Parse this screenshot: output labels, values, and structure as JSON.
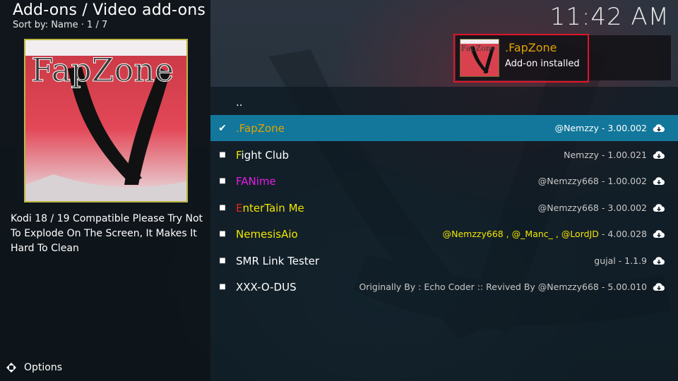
{
  "header": {
    "title": "Add-ons / Video add-ons",
    "subtitle": "Sort by: Name  ·  1 / 7",
    "clock": "11:42 AM"
  },
  "preview": {
    "image_name": "fapzone-addon-artwork",
    "logo_text": "FapZone",
    "description": "Kodi 18 / 19 Compatible Please Try Not To Explode On The Screen, It Makes It Hard To Clean"
  },
  "footer": {
    "options_label": "Options",
    "options_icon": "options-arrows-icon"
  },
  "list": {
    "parent_label": "..",
    "items": [
      {
        "label": ".FapZone",
        "meta": "@Nemzzy - 3.00.002",
        "selected": true,
        "label_color": "#e0a300",
        "meta_color": "#ffffff",
        "icon": "download-cloud-icon"
      },
      {
        "label": "Fight Club",
        "meta": "Nemzzy - 1.00.021",
        "selected": false,
        "first_letter_color": "#f2e600",
        "label_color": "#ffffff",
        "meta_color": "#c8c8c8",
        "icon": "download-cloud-icon"
      },
      {
        "label": "FANime",
        "meta": "@Nemzzy668 - 1.00.002",
        "selected": false,
        "label_color": "#e61ee6",
        "meta_color": "#c8c8c8",
        "icon": "download-cloud-icon"
      },
      {
        "label": "EnterTain Me",
        "meta": "@Nemzzy668 - 3.00.002",
        "selected": false,
        "first_letter_color": "#e02a1a",
        "label_color": "#f2e600",
        "meta_color": "#c8c8c8",
        "icon": "download-cloud-icon"
      },
      {
        "label": "NemesisAio",
        "meta": "@Nemzzy668 , @_Manc_ , @LordJD - 4.00.028",
        "selected": false,
        "label_color": "#f2e600",
        "meta_color": "#f2e600",
        "meta_tail_color": "#c8c8c8",
        "icon": "download-cloud-icon"
      },
      {
        "label": "SMR Link Tester",
        "meta": "gujal - 1.1.9",
        "selected": false,
        "label_color": "#ffffff",
        "meta_color": "#c8c8c8",
        "icon": "download-cloud-icon"
      },
      {
        "label": "XXX-O-DUS",
        "meta": "Originally By : Echo Coder :: Revived By @Nemzzy668 - 5.00.010",
        "selected": false,
        "label_color": "#ffffff",
        "meta_color": "#c8c8c8",
        "icon": "download-cloud-icon"
      }
    ]
  },
  "notification": {
    "title": ".FapZone",
    "message": "Add-on installed",
    "image_name": "fapzone-addon-artwork",
    "logo_text": "FapZone"
  },
  "colors": {
    "selection": "#12779b",
    "accent_orange": "#e0a300",
    "highlight_outline": "#e0142a"
  }
}
